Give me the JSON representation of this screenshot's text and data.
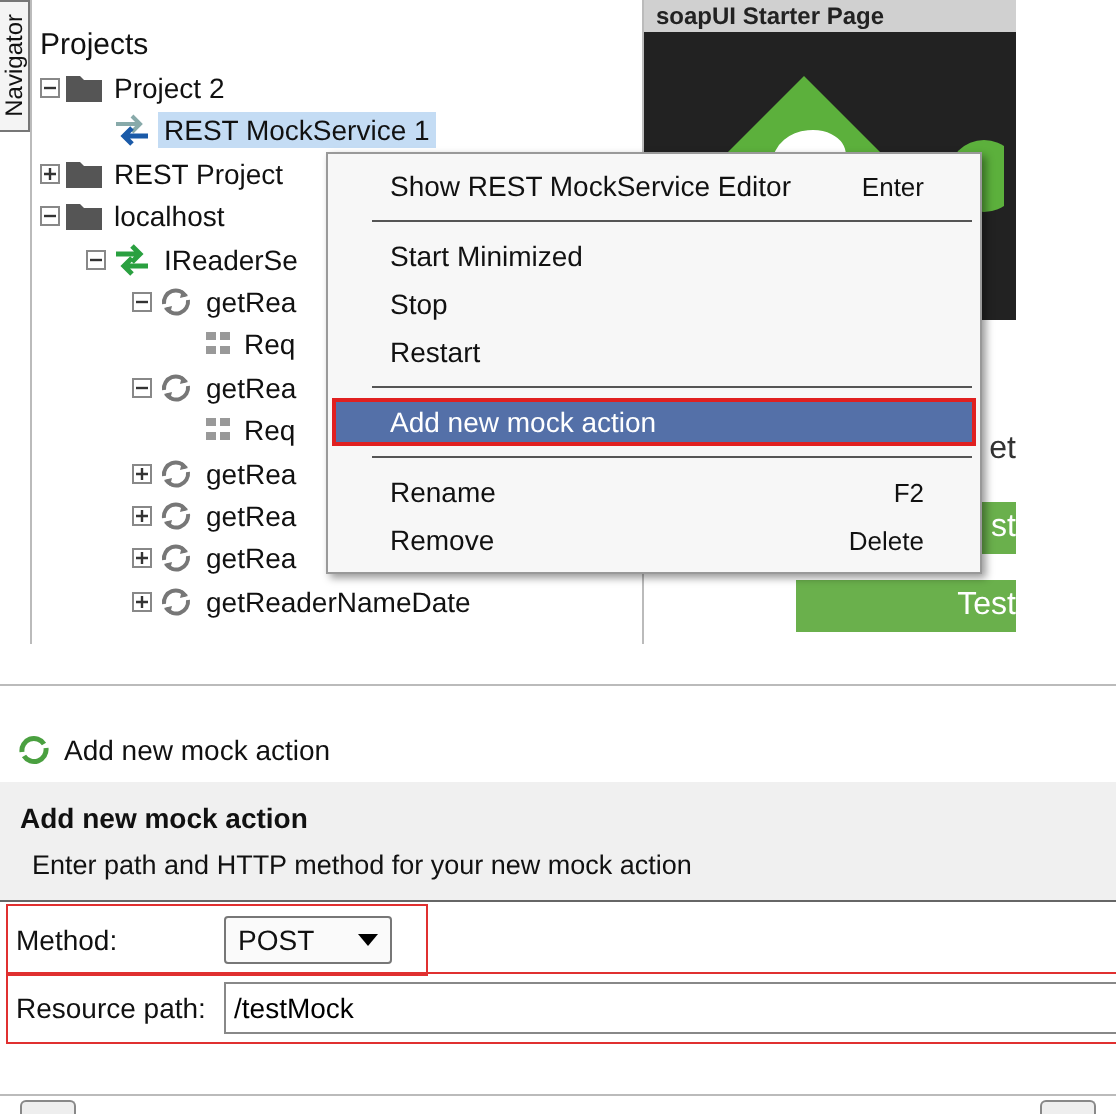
{
  "navigator_tab": {
    "label": "Navigator"
  },
  "tree": {
    "root_label": "Projects",
    "nodes": [
      {
        "label": "Project 2",
        "kind": "folder",
        "expanded": true,
        "selected": false,
        "children": [
          {
            "label": "REST MockService 1",
            "kind": "mock-service",
            "selected": true
          }
        ]
      },
      {
        "label": "REST Project",
        "kind": "folder",
        "expanded": false,
        "selected": false
      },
      {
        "label": "localhost",
        "kind": "folder",
        "expanded": true,
        "selected": false,
        "children": [
          {
            "label": "IReaderSe",
            "kind": "service",
            "expanded": true,
            "selected": false,
            "children": [
              {
                "label": "getRea",
                "kind": "operation",
                "expanded": true,
                "selected": false,
                "children": [
                  {
                    "label": "Req",
                    "kind": "request",
                    "selected": false
                  }
                ]
              },
              {
                "label": "getRea",
                "kind": "operation",
                "expanded": true,
                "selected": false,
                "children": [
                  {
                    "label": "Req",
                    "kind": "request",
                    "selected": false
                  }
                ]
              },
              {
                "label": "getRea",
                "kind": "operation",
                "expanded": false,
                "selected": false
              },
              {
                "label": "getRea",
                "kind": "operation",
                "expanded": false,
                "selected": false
              },
              {
                "label": "getRea",
                "kind": "operation",
                "expanded": false,
                "selected": false
              },
              {
                "label": "getReaderNameDate",
                "kind": "operation",
                "expanded": false,
                "selected": false
              }
            ]
          }
        ]
      }
    ]
  },
  "starter_page": {
    "tab_title": "soapUI Starter Page",
    "fragments": [
      "et",
      "st",
      "Test"
    ]
  },
  "context_menu": {
    "items": [
      {
        "kind": "item",
        "label": "Show REST MockService Editor",
        "shortcut": "Enter",
        "selected": false,
        "highlighted": false
      },
      {
        "kind": "separator"
      },
      {
        "kind": "item",
        "label": "Start Minimized",
        "selected": false,
        "highlighted": false
      },
      {
        "kind": "item",
        "label": "Stop",
        "selected": false,
        "highlighted": false
      },
      {
        "kind": "item",
        "label": "Restart",
        "selected": false,
        "highlighted": false
      },
      {
        "kind": "separator"
      },
      {
        "kind": "item",
        "label": "Add new mock action",
        "selected": true,
        "highlighted": true
      },
      {
        "kind": "separator"
      },
      {
        "kind": "item",
        "label": "Rename",
        "shortcut": "F2",
        "selected": false,
        "highlighted": false
      },
      {
        "kind": "item",
        "label": "Remove",
        "shortcut": "Delete",
        "selected": false,
        "highlighted": false
      }
    ]
  },
  "dialog": {
    "title": "Add new mock action",
    "heading": "Add new mock action",
    "description": "Enter path and HTTP method for your new mock action",
    "fields": [
      {
        "kind": "select",
        "label": "Method:",
        "value": "POST",
        "highlighted": true
      },
      {
        "kind": "text",
        "label": "Resource path:",
        "value": "/testMock",
        "highlighted": true
      }
    ]
  }
}
